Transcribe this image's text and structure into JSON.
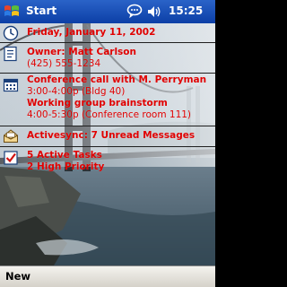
{
  "titlebar": {
    "start_label": "Start",
    "time": "15:25"
  },
  "today": {
    "date": "Friday, January 11, 2002",
    "owner": {
      "name": "Owner: Matt Carlson",
      "phone": "(425) 555-1234"
    },
    "calendar": {
      "event1_title": "Conference call with M. Perryman",
      "event1_time": "3:00-4:00p (Bldg 40)",
      "event2_title": "Working group brainstorm",
      "event2_time": "4:00-5:30p (Conference room 111)"
    },
    "inbox": "Activesync: 7 Unread Messages",
    "tasks": {
      "active": "5 Active Tasks",
      "priority": "2 High Priority"
    }
  },
  "commandbar": {
    "new_label": "New"
  },
  "colors": {
    "titlebar": "#1a50b8",
    "item_text": "#e00000",
    "commandbar": "#e4e1d8"
  },
  "icons": [
    "windows-flag-icon",
    "message-bubble-icon",
    "speaker-icon",
    "clock-icon",
    "owner-card-icon",
    "calendar-icon",
    "inbox-icon",
    "tasks-checkbox-icon"
  ]
}
